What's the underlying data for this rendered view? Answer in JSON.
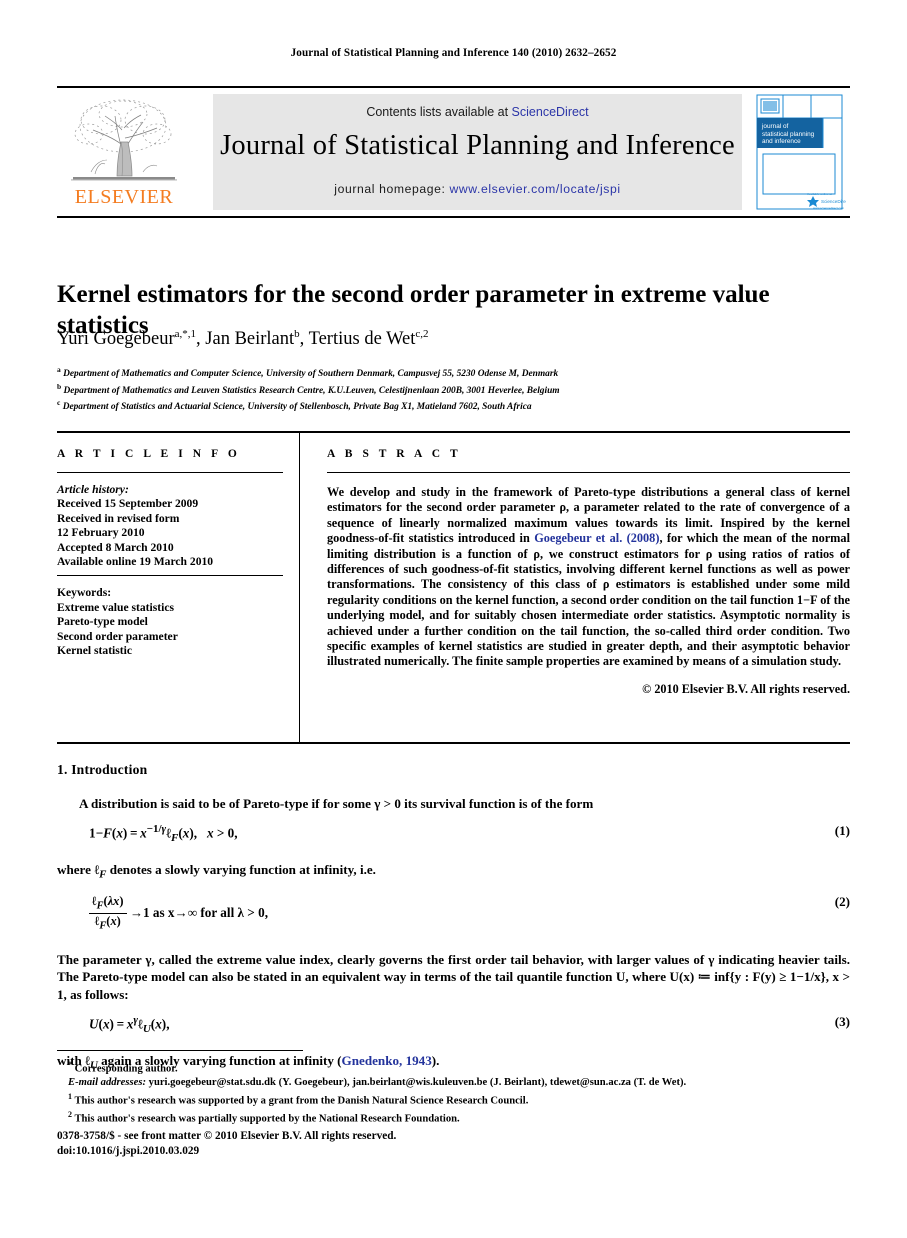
{
  "running_head": "Journal of Statistical Planning and Inference 140 (2010) 2632–2652",
  "masthead": {
    "publisher_name": "ELSEVIER",
    "contents_prefix": "Contents lists available at ",
    "contents_link": "ScienceDirect",
    "journal_title": "Journal of Statistical Planning and Inference",
    "homepage_prefix": "journal homepage: ",
    "homepage_link": "www.elsevier.com/locate/jspi",
    "cover": {
      "line1": "journal of",
      "line2": "statistical planning",
      "line3": "and inference",
      "color": "#1b8ad3"
    }
  },
  "article": {
    "title": "Kernel estimators for the second order parameter in extreme value statistics",
    "authors_html": "Yuri Goegebeur<sup>a,*,1</sup>, Jan Beirlant<sup>b</sup>, Tertius de Wet<sup>c,2</sup>",
    "affiliations": [
      {
        "marker": "a",
        "text": "Department of Mathematics and Computer Science, University of Southern Denmark, Campusvej 55, 5230 Odense M, Denmark"
      },
      {
        "marker": "b",
        "text": "Department of Mathematics and Leuven Statistics Research Centre, K.U.Leuven, Celestijnenlaan 200B, 3001 Heverlee, Belgium"
      },
      {
        "marker": "c",
        "text": "Department of Statistics and Actuarial Science, University of Stellenbosch, Private Bag X1, Matieland 7602, South Africa"
      }
    ]
  },
  "article_info": {
    "heading": "A R T I C L E   I N F O",
    "history_label": "Article history:",
    "history_lines": [
      "Received 15 September 2009",
      "Received in revised form",
      "12 February 2010",
      "Accepted 8 March 2010",
      "Available online 19 March 2010"
    ],
    "keywords_label": "Keywords:",
    "keywords": [
      "Extreme value statistics",
      "Pareto-type model",
      "Second order parameter",
      "Kernel statistic"
    ]
  },
  "abstract": {
    "heading": "A B S T R A C T",
    "part1": "We develop and study in the framework of Pareto-type distributions a general class of kernel estimators for the second order parameter ρ, a parameter related to the rate of convergence of a sequence of linearly normalized maximum values towards its limit. Inspired by the kernel goodness-of-fit statistics introduced in ",
    "citation": "Goegebeur et al. (2008)",
    "part2": ", for which the mean of the normal limiting distribution is a function of ρ, we construct estimators for ρ using ratios of ratios of differences of such goodness-of-fit statistics, involving different kernel functions as well as power transformations. The consistency of this class of ρ estimators is established under some mild regularity conditions on the kernel function, a second order condition on the tail function 1−F of the underlying model, and for suitably chosen intermediate order statistics. Asymptotic normality is achieved under a further condition on the tail function, the so-called third order condition. Two specific examples of kernel statistics are studied in greater depth, and their asymptotic behavior illustrated numerically. The finite sample properties are examined by means of a simulation study.",
    "copyright": "© 2010 Elsevier B.V. All rights reserved."
  },
  "body": {
    "section_number_title": "1.  Introduction",
    "p1": "A distribution is said to be of Pareto-type if for some γ > 0 its survival function is of the form",
    "eq1_num": "(1)",
    "p2_pre": "where ",
    "p2_post": " denotes a slowly varying function at infinity, i.e.",
    "eq2_tail": "→1   as x→∞ for all  λ > 0,",
    "eq2_num": "(2)",
    "p3": "The parameter γ, called the extreme value index, clearly governs the first order tail behavior, with larger values of γ indicating heavier tails. The Pareto-type model can also be stated in an equivalent way in terms of the tail quantile function U, where U(x) ≔ inf{y : F(y) ≥ 1−1/x}, x > 1, as follows:",
    "eq3_num": "(3)",
    "p4_pre": "with ",
    "p4_mid": " again a slowly varying function at infinity (",
    "p4_citation": "Gnedenko, 1943",
    "p4_post": ")."
  },
  "footnotes": {
    "corresponding": "Corresponding author.",
    "email_label": "E-mail addresses:",
    "email_text": "yuri.goegebeur@stat.sdu.dk (Y. Goegebeur), jan.beirlant@wis.kuleuven.be (J. Beirlant), tdewet@sun.ac.za (T. de Wet).",
    "note1": "This author's research was supported by a grant from the Danish Natural Science Research Council.",
    "note2": "This author's research was partially supported by the National Research Foundation."
  },
  "imprint": {
    "line1": "0378-3758/$ - see front matter © 2010 Elsevier B.V. All rights reserved.",
    "line2": "doi:10.1016/j.jspi.2010.03.029"
  }
}
